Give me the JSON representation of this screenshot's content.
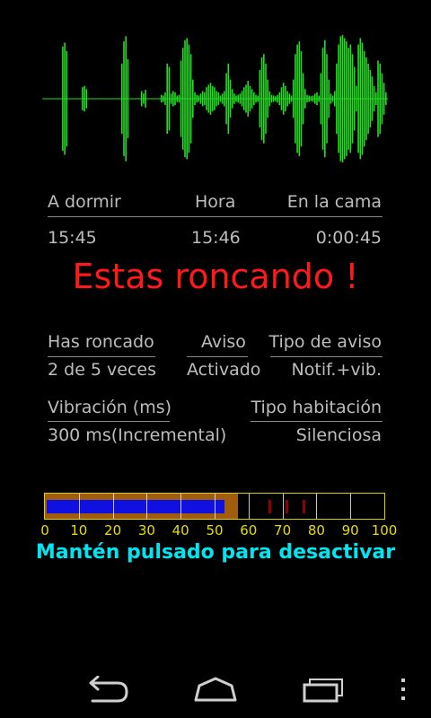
{
  "waveform": {
    "color": "#22dd22",
    "amplitudes": [
      0,
      0,
      0,
      0,
      0,
      0,
      0,
      0,
      0,
      0,
      0.82,
      0.88,
      0.75,
      0,
      0,
      0,
      0,
      0,
      0,
      0,
      0.18,
      0.2,
      0.15,
      0,
      0,
      0,
      0,
      0,
      0,
      0,
      0,
      0,
      0,
      0,
      0,
      0,
      0,
      0,
      0,
      0,
      0.55,
      0.9,
      0.98,
      0.62,
      0,
      0,
      0,
      0,
      0,
      0,
      0.12,
      0.08,
      0.14,
      0,
      0,
      0,
      0,
      0,
      0,
      0,
      0.06,
      0.05,
      0.1,
      0.55,
      0.5,
      0.08,
      0.12,
      0.1,
      0.05,
      0.06,
      0.6,
      0.8,
      0.92,
      0.95,
      0.85,
      0.7,
      0.3,
      0.1,
      0.06,
      0.05,
      0.08,
      0.12,
      0.1,
      0.18,
      0.22,
      0.25,
      0.2,
      0.18,
      0.12,
      0.1,
      0.05,
      0.08,
      0.12,
      0.4,
      0.55,
      0.3,
      0.15,
      0.08,
      0.05,
      0.06,
      0.08,
      0.12,
      0.18,
      0.22,
      0.28,
      0.2,
      0.15,
      0.1,
      0.06,
      0.05,
      0.45,
      0.65,
      0.7,
      0.55,
      0.3,
      0.12,
      0.06,
      0.05,
      0.04,
      0.06,
      0.1,
      0.18,
      0.25,
      0.2,
      0.12,
      0.08,
      0.05,
      0.3,
      0.7,
      0.85,
      0.9,
      0.75,
      0.4,
      0.15,
      0.06,
      0.05,
      0.04,
      0.05,
      0.08,
      0.1,
      0.05,
      0.4,
      0.8,
      0.92,
      0.7,
      0.3,
      0.08,
      0.05,
      0.12,
      0.55,
      0.85,
      0.98,
      1.0,
      0.95,
      0.9,
      0.8,
      0.85,
      0.7,
      0.5,
      0.2,
      0.85,
      0.95,
      0.88,
      0.75,
      0.65,
      0.55,
      0.45,
      0.35,
      0.2,
      0.1,
      0.6,
      0.55,
      0.4,
      0.25,
      0.1
    ]
  },
  "stats": {
    "col1_label": "A dormir",
    "col2_label": "Hora",
    "col3_label": "En la cama",
    "col1_value": "15:45",
    "col2_value": "15:46",
    "col3_value": "0:00:45"
  },
  "alert": {
    "text": "Estas roncando !",
    "color": "#ff1a1a"
  },
  "settings": {
    "snored_label": "Has roncado",
    "snored_value": "2 de 5 veces",
    "alert_label": "Aviso",
    "alert_value": "Activado",
    "alert_type_label": "Tipo de aviso",
    "alert_type_value": "Notif.+vib.",
    "vibration_label": "Vibración (ms)",
    "vibration_value": "300 ms(Incremental)",
    "room_type_label": "Tipo habitación",
    "room_type_value": "Silenciosa"
  },
  "meter": {
    "scale": [
      "0",
      "10",
      "20",
      "30",
      "40",
      "50",
      "60",
      "70",
      "80",
      "90",
      "100"
    ],
    "threshold": 57,
    "level": 53,
    "peaks": [
      66,
      71,
      76
    ],
    "fill_color": "#a15d0c",
    "level_color": "#1010e0",
    "peak_color": "#8b0000"
  },
  "hint": {
    "text": "Mantén pulsado para desactivar",
    "color": "#00e5f0"
  },
  "navbar": {
    "back_icon": "back-icon",
    "home_icon": "home-icon",
    "recents_icon": "recents-icon",
    "menu_icon": "overflow-menu-icon"
  }
}
